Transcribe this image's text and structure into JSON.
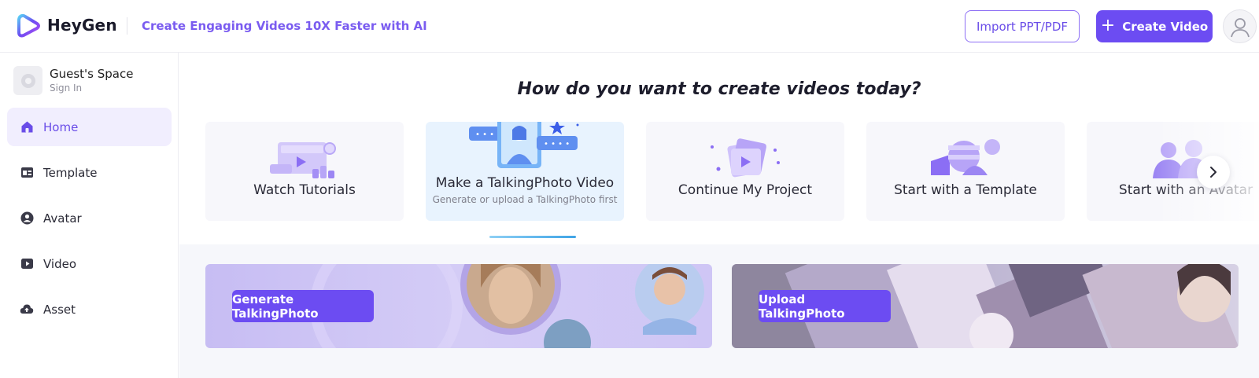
{
  "header": {
    "brand": "HeyGen",
    "tagline": "Create Engaging Videos 10X Faster with AI",
    "import_label": "Import PPT/PDF",
    "create_label": "Create Video",
    "create_icon": "plus-icon",
    "avatar_icon": "user-avatar-icon"
  },
  "sidebar": {
    "space_name": "Guest's Space",
    "space_sign_in": "Sign In",
    "items": [
      {
        "label": "Home",
        "icon": "home-icon",
        "active": true
      },
      {
        "label": "Template",
        "icon": "template-icon",
        "active": false
      },
      {
        "label": "Avatar",
        "icon": "avatar-icon",
        "active": false
      },
      {
        "label": "Video",
        "icon": "video-icon",
        "active": false
      },
      {
        "label": "Asset",
        "icon": "cloud-upload-icon",
        "active": false
      }
    ]
  },
  "main": {
    "question": "How do you want to create videos today?",
    "cards": [
      {
        "title": "Watch Tutorials",
        "subtitle": ""
      },
      {
        "title": "Make a TalkingPhoto Video",
        "subtitle": "Generate or upload a TalkingPhoto first",
        "active": true
      },
      {
        "title": "Continue My Project",
        "subtitle": ""
      },
      {
        "title": "Start with a Template",
        "subtitle": ""
      },
      {
        "title": "Start with an Avatar",
        "subtitle": ""
      }
    ],
    "carousel_progress": 0.5,
    "banners": {
      "generate_label": "Generate TalkingPhoto",
      "upload_label": "Upload TalkingPhoto"
    }
  },
  "colors": {
    "accent": "#6c4cf2",
    "accent_text": "#7a5cf0",
    "active_card": "#e8f3fe",
    "nav_active_bg": "#f1eefe"
  }
}
